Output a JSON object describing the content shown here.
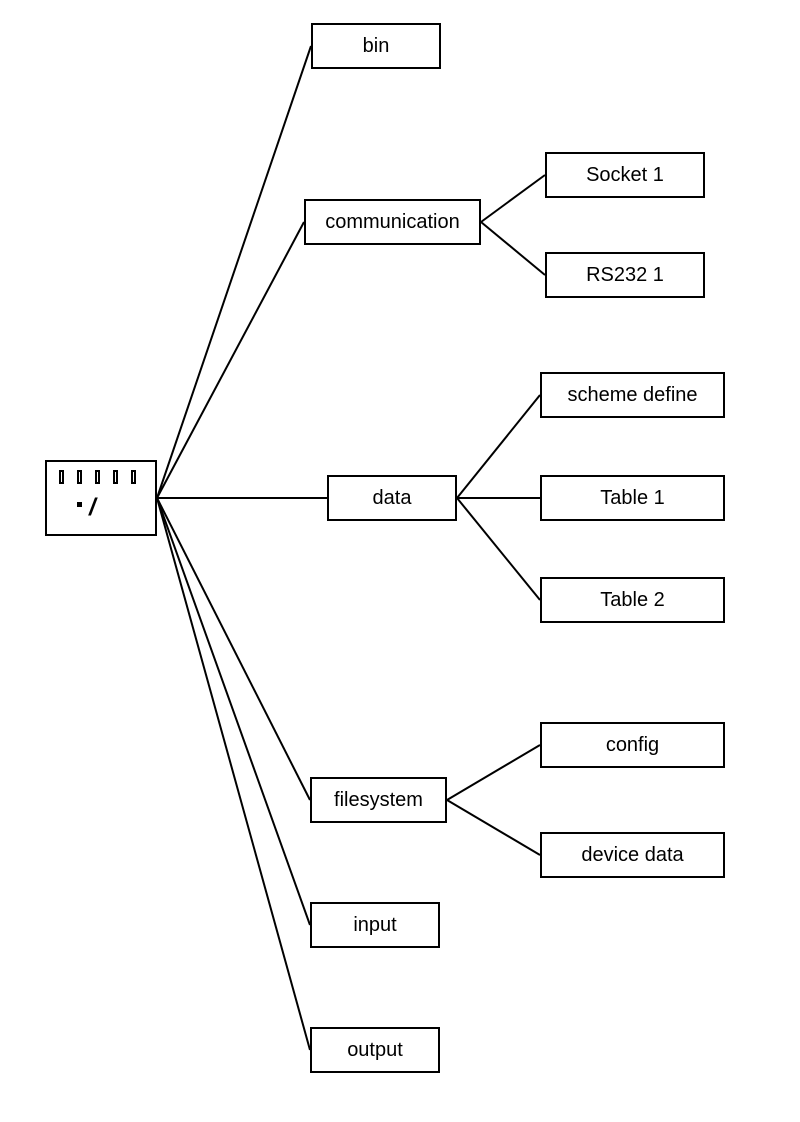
{
  "root": {
    "label": " /"
  },
  "level1": {
    "bin": "bin",
    "communication": "communication",
    "data": "data",
    "filesystem": "filesystem",
    "input": "input",
    "output": "output"
  },
  "communication_children": {
    "socket1": "Socket 1",
    "rs232_1": "RS232 1"
  },
  "data_children": {
    "scheme_define": "scheme define",
    "table1": "Table 1",
    "table2": "Table 2"
  },
  "filesystem_children": {
    "config": "config",
    "device_data": "device data"
  }
}
